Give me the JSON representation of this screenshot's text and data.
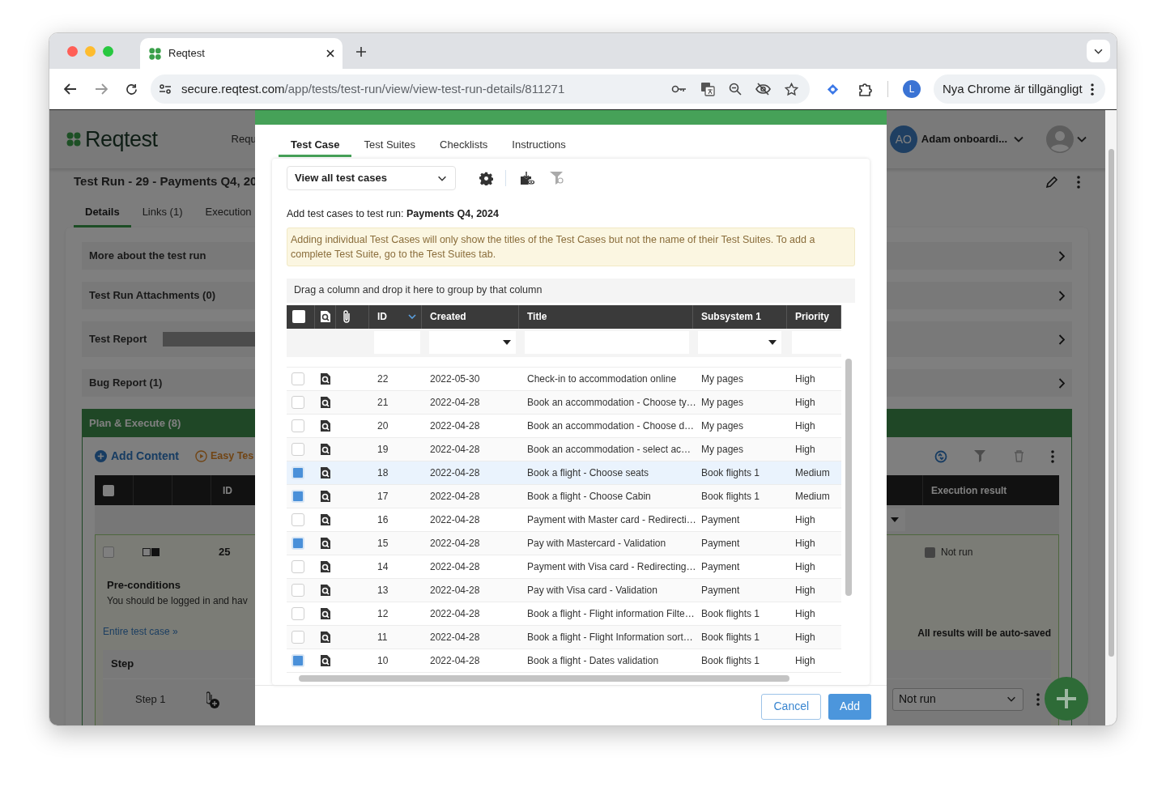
{
  "browser": {
    "tab_title": "Reqtest",
    "url_host": "secure.reqtest.com",
    "url_path": "/app/tests/test-run/view/view-test-run-details/811271",
    "profile_initial": "L",
    "update_button": "Nya Chrome är tillgängligt"
  },
  "app": {
    "logo": "Reqtest",
    "nav_item": "Requ",
    "user_initials": "AO",
    "user_name": "Adam onboardi...",
    "title": "Test Run - 29 - Payments Q4, 20",
    "tabs": [
      {
        "label": "Details",
        "selected": true
      },
      {
        "label": "Links (1)",
        "selected": false
      },
      {
        "label": "Execution",
        "selected": false
      }
    ],
    "sections": [
      {
        "label": "More about the test run",
        "kind": "plain"
      },
      {
        "label": "Test Run Attachments (0)",
        "kind": "plain"
      },
      {
        "label": "Test Report",
        "kind": "report"
      },
      {
        "label": "Bug Report (1)",
        "kind": "plain"
      }
    ],
    "plan": {
      "title": "Plan & Execute (8)",
      "header_checked": false,
      "row_checked": false,
      "add_content": "Add Content",
      "easy_test": "Easy Tes",
      "id_column": "ID",
      "result_column": "Execution result",
      "row_id": "25",
      "row_result": "Not run",
      "precond_label": "Pre-conditions",
      "precond_text": "You should be logged in and hav",
      "entire_link": "Entire test case »",
      "autosave_note": "All results will be auto-saved",
      "step_header": "Step",
      "step_label": "Step 1",
      "step_result": "Not run"
    }
  },
  "modal": {
    "tabs": [
      {
        "label": "Test Case",
        "selected": true
      },
      {
        "label": "Test Suites",
        "selected": false
      },
      {
        "label": "Checklists",
        "selected": false
      },
      {
        "label": "Instructions",
        "selected": false
      }
    ],
    "view_select": "View all test cases",
    "select_all_checked": false,
    "run_label": "Add test cases to test run:  **Payments Q4, 2024**",
    "notice": "Adding individual Test Cases will only show the titles of the Test Cases but not the name of their Test Suites. To add a complete Test Suite, go to the Test Suites tab.",
    "group_hint": "Drag a column and drop it here to group by that column",
    "columns": [
      {
        "label": "ID",
        "sorted": true
      },
      {
        "label": "Created",
        "sorted": false
      },
      {
        "label": "Title",
        "sorted": false
      },
      {
        "label": "Subsystem 1",
        "sorted": false
      },
      {
        "label": "Priority",
        "sorted": false
      }
    ],
    "rows": [
      {
        "id": "22",
        "created": "2022-05-30",
        "title": "Check-in to accommodation online",
        "subsystem": "My pages",
        "priority": "High",
        "selected": false,
        "hovered": false
      },
      {
        "id": "21",
        "created": "2022-04-28",
        "title": "Book an accommodation - Choose ty…",
        "subsystem": "My pages",
        "priority": "High",
        "selected": false,
        "hovered": false
      },
      {
        "id": "20",
        "created": "2022-04-28",
        "title": "Book an accommodation - Choose d…",
        "subsystem": "My pages",
        "priority": "High",
        "selected": false,
        "hovered": false
      },
      {
        "id": "19",
        "created": "2022-04-28",
        "title": "Book an accommodation - select ac…",
        "subsystem": "My pages",
        "priority": "High",
        "selected": false,
        "hovered": false
      },
      {
        "id": "18",
        "created": "2022-04-28",
        "title": "Book a flight - Choose seats",
        "subsystem": "Book flights 1",
        "priority": "Medium",
        "selected": true,
        "hovered": true
      },
      {
        "id": "17",
        "created": "2022-04-28",
        "title": "Book a flight - Choose Cabin",
        "subsystem": "Book flights 1",
        "priority": "Medium",
        "selected": true,
        "hovered": false
      },
      {
        "id": "16",
        "created": "2022-04-28",
        "title": "Payment with Master card - Redirecti…",
        "subsystem": "Payment",
        "priority": "High",
        "selected": false,
        "hovered": false
      },
      {
        "id": "15",
        "created": "2022-04-28",
        "title": "Pay with Mastercard - Validation",
        "subsystem": "Payment",
        "priority": "High",
        "selected": true,
        "hovered": false
      },
      {
        "id": "14",
        "created": "2022-04-28",
        "title": "Payment with Visa card - Redirecting…",
        "subsystem": "Payment",
        "priority": "High",
        "selected": false,
        "hovered": false
      },
      {
        "id": "13",
        "created": "2022-04-28",
        "title": "Pay with Visa card - Validation",
        "subsystem": "Payment",
        "priority": "High",
        "selected": false,
        "hovered": false
      },
      {
        "id": "12",
        "created": "2022-04-28",
        "title": "Book a flight - Flight information Filte…",
        "subsystem": "Book flights 1",
        "priority": "High",
        "selected": false,
        "hovered": false
      },
      {
        "id": "11",
        "created": "2022-04-28",
        "title": "Book a flight - Flight Information sort…",
        "subsystem": "Book flights 1",
        "priority": "High",
        "selected": false,
        "hovered": false
      },
      {
        "id": "10",
        "created": "2022-04-28",
        "title": "Book a flight - Dates validation",
        "subsystem": "Book flights 1",
        "priority": "High",
        "selected": true,
        "hovered": false
      }
    ],
    "cancel": "Cancel",
    "add": "Add"
  }
}
